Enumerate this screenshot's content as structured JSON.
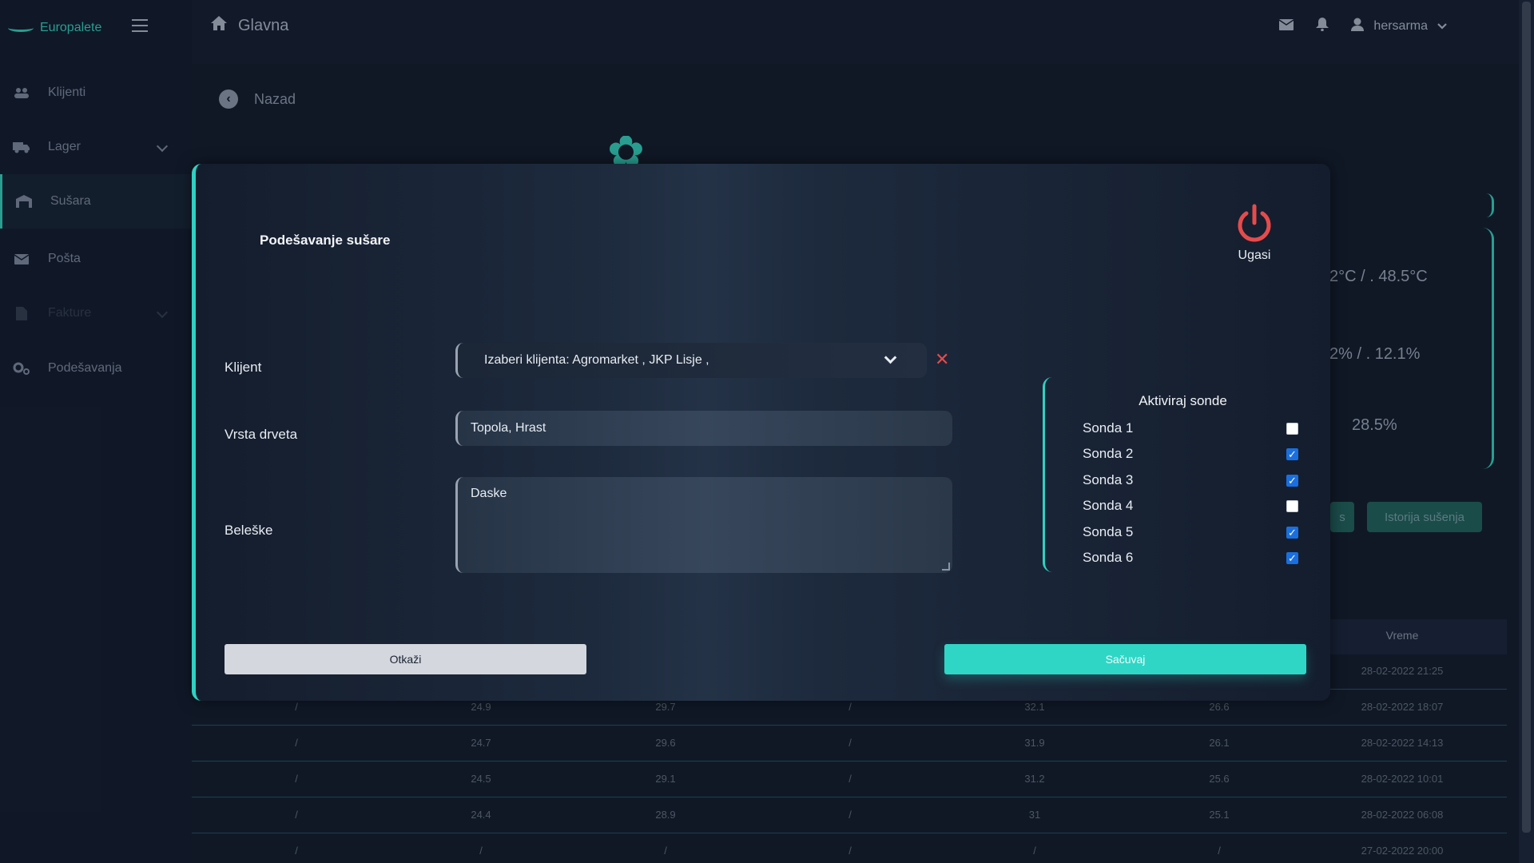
{
  "brand": {
    "name": "Europalete"
  },
  "sidebar": {
    "items": [
      {
        "label": "Klijenti",
        "icon": "users-icon"
      },
      {
        "label": "Lager",
        "icon": "truck-icon"
      },
      {
        "label": "Sušara",
        "icon": "warehouse-icon"
      },
      {
        "label": "Pošta",
        "icon": "mail-icon"
      },
      {
        "label": "Fakture",
        "icon": "file-icon"
      },
      {
        "label": "Podešavanja",
        "icon": "cogs-icon"
      }
    ]
  },
  "topbar": {
    "title": "Glavna",
    "user": "hersarma"
  },
  "page": {
    "back_label": "Nazad"
  },
  "background_stats": {
    "temp": "2°C / . 48.5°C",
    "humidity": "2% / . 12.1%",
    "moisture": "28.5%"
  },
  "background_buttons": {
    "b1": "s",
    "b2": "Istorija sušenja"
  },
  "table": {
    "time_header": "Vreme",
    "rows": [
      [
        "",
        "",
        "",
        "",
        "",
        "",
        "28-02-2022 21:25"
      ],
      [
        "/",
        "24.9",
        "29.7",
        "/",
        "32.1",
        "26.6",
        "28-02-2022 18:07"
      ],
      [
        "/",
        "24.7",
        "29.6",
        "/",
        "31.9",
        "26.1",
        "28-02-2022 14:13"
      ],
      [
        "/",
        "24.5",
        "29.1",
        "/",
        "31.2",
        "25.6",
        "28-02-2022 10:01"
      ],
      [
        "/",
        "24.4",
        "28.9",
        "/",
        "31",
        "25.1",
        "28-02-2022 06:08"
      ],
      [
        "/",
        "/",
        "/",
        "/",
        "/",
        "/",
        "27-02-2022 20:00"
      ]
    ]
  },
  "modal": {
    "title": "Podešavanje sušare",
    "power_label": "Ugasi",
    "client_label": "Klijent",
    "client_value": "Izaberi klijenta: Agromarket , JKP Lisje ,",
    "wood_label": "Vrsta drveta",
    "wood_value": "Topola, Hrast",
    "notes_label": "Beleške",
    "notes_value": "Daske",
    "probes_title": "Aktiviraj sonde",
    "probes": [
      {
        "label": "Sonda 1",
        "checked": false
      },
      {
        "label": "Sonda 2",
        "checked": true
      },
      {
        "label": "Sonda 3",
        "checked": true
      },
      {
        "label": "Sonda 4",
        "checked": false
      },
      {
        "label": "Sonda 5",
        "checked": true
      },
      {
        "label": "Sonda 6",
        "checked": true
      }
    ],
    "cancel_label": "Otkaži",
    "save_label": "Sačuvaj"
  },
  "colors": {
    "accent": "#2fd1c1",
    "danger": "#e64b4b",
    "background": "#121a29"
  }
}
